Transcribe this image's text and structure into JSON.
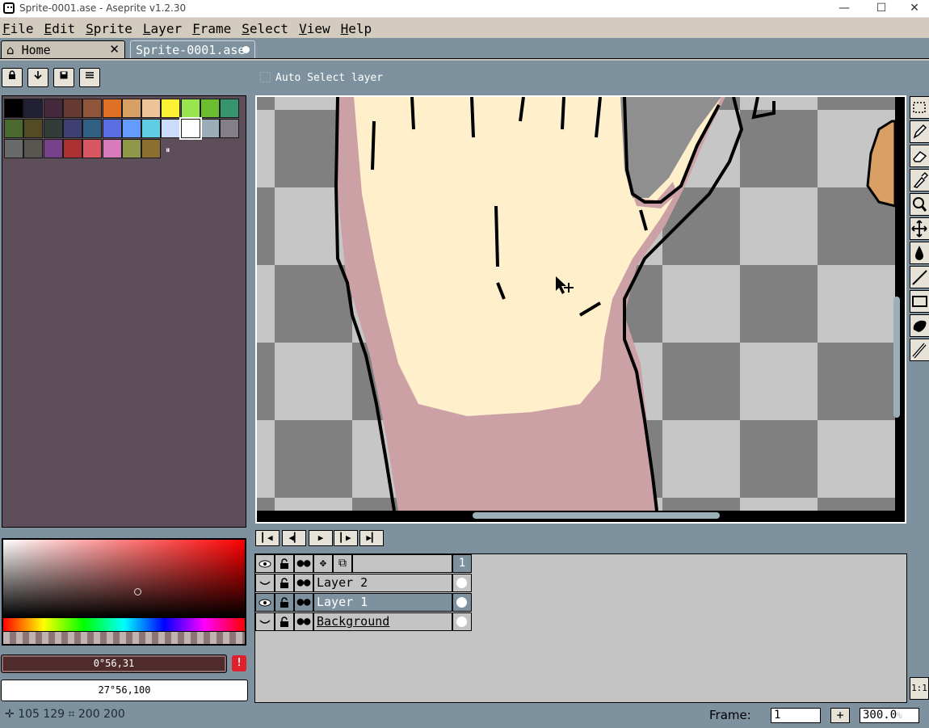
{
  "window": {
    "title": "Sprite-0001.ase - Aseprite v1.2.30",
    "minimize": "—",
    "maximize": "☐",
    "close": "✕"
  },
  "menu": [
    "File",
    "Edit",
    "Sprite",
    "Layer",
    "Frame",
    "Select",
    "View",
    "Help"
  ],
  "tabs": {
    "home": "Home",
    "home_close": "✕",
    "sprite": "Sprite-0001.ase"
  },
  "palette_toolbar": [
    "lock-icon",
    "sort-icon",
    "save-icon",
    "options-icon"
  ],
  "palette": {
    "colors": [
      "#000000",
      "#222034",
      "#45283c",
      "#663931",
      "#8f563b",
      "#df7126",
      "#d9a066",
      "#eec39a",
      "#fbf236",
      "#99e550",
      "#6abe30",
      "#37946e",
      "#4b692f",
      "#524b24",
      "#323c39",
      "#3f3f74",
      "#306082",
      "#5b6ee1",
      "#639bff",
      "#5fcde4",
      "#cbdbfc",
      "#ffffff",
      "#9badb7",
      "#847e87",
      "#696a6a",
      "#595652",
      "#76428a",
      "#ac3232",
      "#d95763",
      "#d77bba",
      "#8f974a",
      "#8a6f30"
    ],
    "selected_index": 21,
    "marker": "⏸"
  },
  "color": {
    "foreground": "0°56,31",
    "background": "27°56,100",
    "warning": "!"
  },
  "editor": {
    "auto_select_label": "Auto Select layer"
  },
  "tools": [
    "marquee-tool",
    "pencil-tool",
    "eraser-tool",
    "eyedropper-tool",
    "zoom-tool",
    "move-tool",
    "fill-tool",
    "line-tool",
    "rectangle-tool",
    "contour-tool",
    "blur-tool"
  ],
  "one_to_one": "1:1",
  "timeline": {
    "frame_header": "1",
    "layers": [
      {
        "name": "Layer 2",
        "visible": false,
        "selected": false
      },
      {
        "name": "Layer 1",
        "visible": true,
        "selected": true
      },
      {
        "name": "Background",
        "visible": false,
        "selected": false
      }
    ]
  },
  "status": {
    "position": "105  129",
    "size": "200  200",
    "frame_label": "Frame:",
    "frame_value": "1",
    "zoom_value": "300.0",
    "zoom_unit": "%"
  }
}
